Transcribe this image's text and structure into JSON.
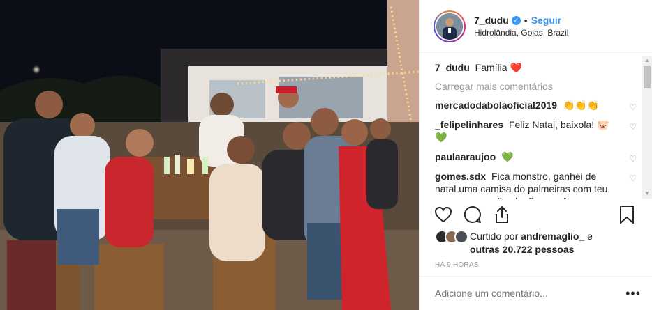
{
  "header": {
    "username": "7_dudu",
    "separator": "•",
    "follow_label": "Seguir",
    "location": "Hidrolândia, Goias, Brazil"
  },
  "caption": {
    "username": "7_dudu",
    "text": "Família",
    "emoji": "❤️"
  },
  "load_more": "Carregar mais comentários",
  "comments": [
    {
      "user": "mercadodabolaoficial2019",
      "text": "👏👏👏"
    },
    {
      "user": "_felipelinhares",
      "text": "Feliz Natal, baixola! 🐷 💚"
    },
    {
      "user": "paulaaraujoo",
      "text": "💚"
    },
    {
      "user": "gomes.sdx",
      "text": "Fica monstro, ganhei de natal uma camisa do palmeiras com teu nome personalizado, fica por favor"
    }
  ],
  "likes": {
    "prefix": "Curtido por",
    "user": "andremaglio_",
    "conj": "e",
    "others": "outras 20.722 pessoas"
  },
  "timestamp": "HÁ 9 HORAS",
  "add_comment_placeholder": "Adicione um comentário...",
  "icons": [
    "heart-icon",
    "comment-icon",
    "share-icon",
    "bookmark-icon",
    "verified-icon",
    "more-options-icon"
  ],
  "colors": {
    "link": "#3897f0",
    "heart": "#ed4956",
    "green_heart": "#4ac634"
  }
}
